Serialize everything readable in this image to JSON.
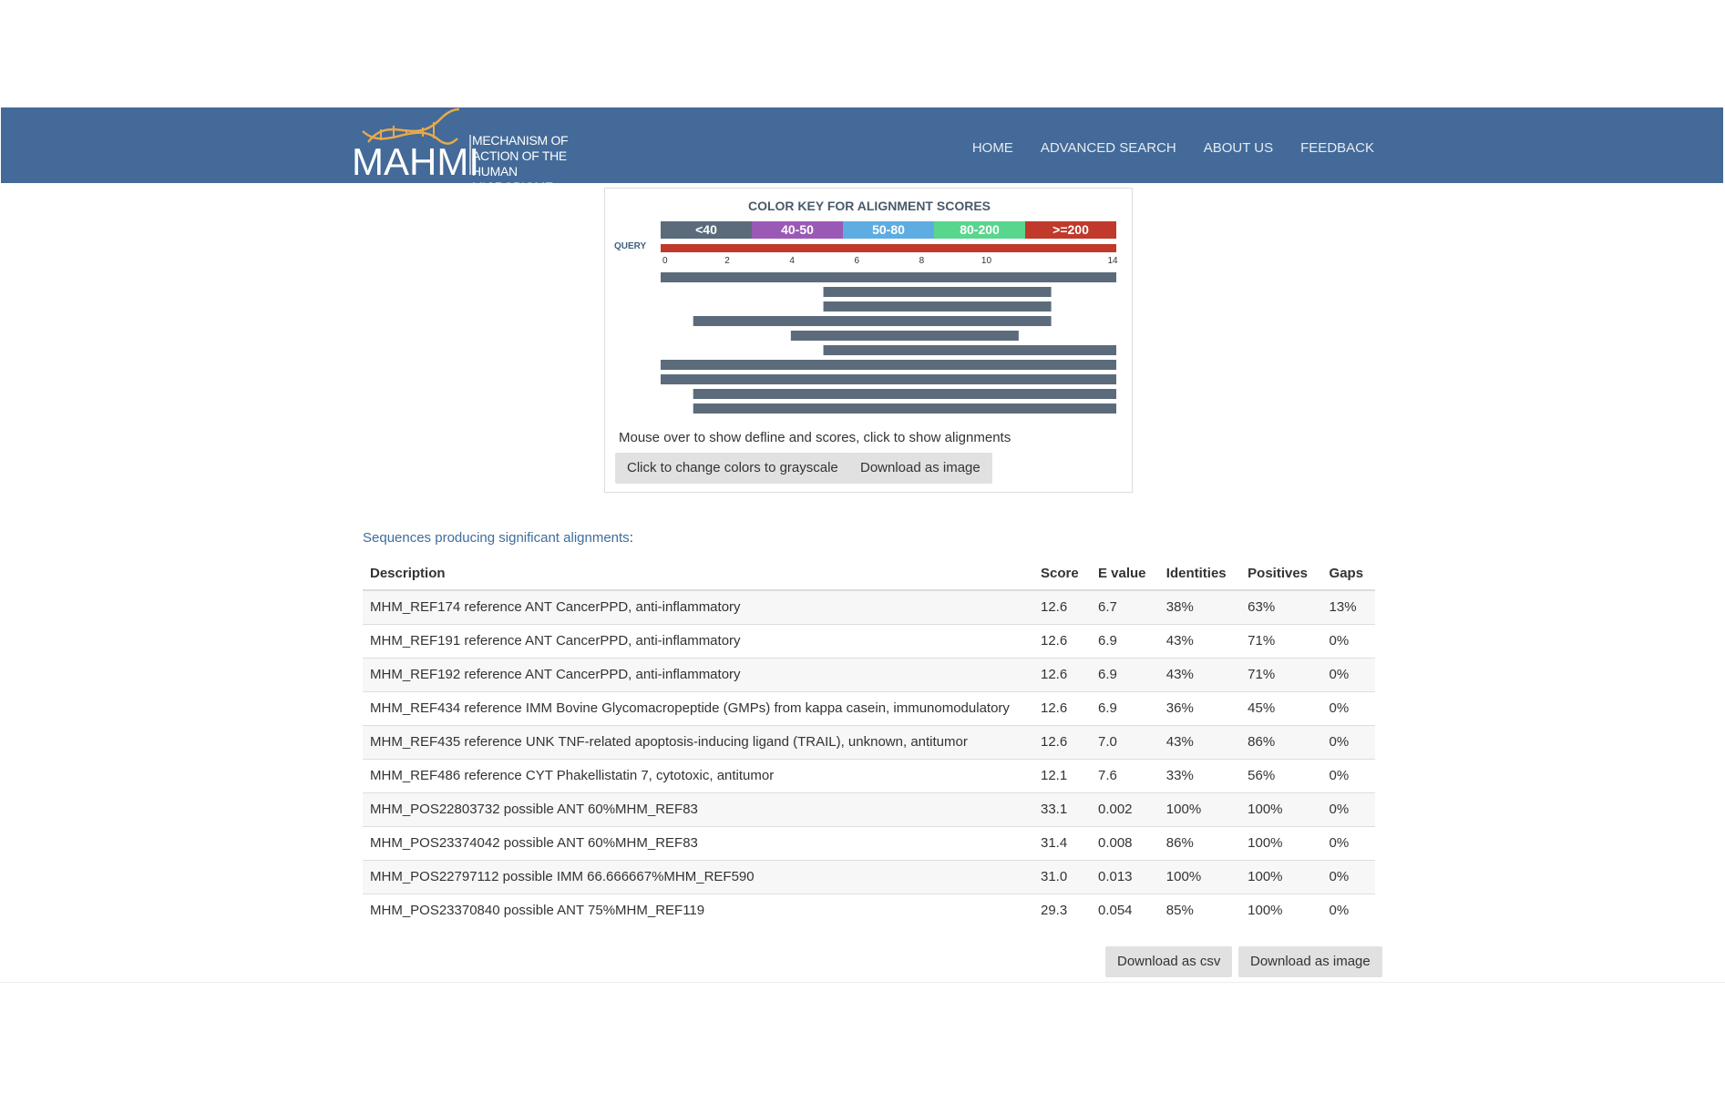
{
  "header": {
    "logo_text": "MAHMI",
    "tagline": [
      "MECHANISM OF",
      "ACTION OF THE",
      "HUMAN MICROBIOME"
    ],
    "nav": [
      "HOME",
      "ADVANCED SEARCH",
      "ABOUT US",
      "FEEDBACK"
    ],
    "colors": {
      "navbar": "#436a98",
      "logo_accent": "#e8a94a"
    }
  },
  "graphic": {
    "title": "COLOR KEY FOR ALIGNMENT SCORES",
    "legend": [
      {
        "label": "<40",
        "color": "#5b6b7b"
      },
      {
        "label": "40-50",
        "color": "#9b59b6"
      },
      {
        "label": "50-80",
        "color": "#5dade2"
      },
      {
        "label": "80-200",
        "color": "#58d68d"
      },
      {
        "label": ">=200",
        "color": "#c0392b"
      }
    ],
    "query_label": "QUERY",
    "query_color": "#c0392b",
    "axis_ticks": [
      "0",
      "2",
      "4",
      "6",
      "8",
      "10",
      "14"
    ],
    "axis_max": 14,
    "hits": [
      {
        "start": 0,
        "end": 14,
        "color": "#5b6b7b"
      },
      {
        "start": 5,
        "end": 12,
        "color": "#5b6b7b"
      },
      {
        "start": 5,
        "end": 12,
        "color": "#5b6b7b"
      },
      {
        "start": 1,
        "end": 12,
        "color": "#5b6b7b"
      },
      {
        "start": 4,
        "end": 11,
        "color": "#5b6b7b"
      },
      {
        "start": 5,
        "end": 14,
        "color": "#5b6b7b"
      },
      {
        "start": 0,
        "end": 14,
        "color": "#5b6b7b"
      },
      {
        "start": 0,
        "end": 14,
        "color": "#5b6b7b"
      },
      {
        "start": 1,
        "end": 14,
        "color": "#5b6b7b"
      },
      {
        "start": 1,
        "end": 14,
        "color": "#5b6b7b"
      }
    ],
    "help_text": "Mouse over to show defline and scores, click to show alignments",
    "grayscale_button": "Click to change colors to grayscale",
    "download_image_button": "Download as image"
  },
  "results": {
    "heading": "Sequences producing significant alignments",
    "heading_colon": ":",
    "columns": [
      "Description",
      "Score",
      "E value",
      "Identities",
      "Positives",
      "Gaps"
    ],
    "rows": [
      [
        "MHM_REF174 reference ANT CancerPPD, anti-inflammatory",
        "12.6",
        "6.7",
        "38%",
        "63%",
        "13%"
      ],
      [
        "MHM_REF191 reference ANT CancerPPD, anti-inflammatory",
        "12.6",
        "6.9",
        "43%",
        "71%",
        "0%"
      ],
      [
        "MHM_REF192 reference ANT CancerPPD, anti-inflammatory",
        "12.6",
        "6.9",
        "43%",
        "71%",
        "0%"
      ],
      [
        "MHM_REF434 reference IMM Bovine Glycomacropeptide (GMPs) from kappa casein, immunomodulatory",
        "12.6",
        "6.9",
        "36%",
        "45%",
        "0%"
      ],
      [
        "MHM_REF435 reference UNK TNF-related apoptosis-inducing ligand (TRAIL), unknown, antitumor",
        "12.6",
        "7.0",
        "43%",
        "86%",
        "0%"
      ],
      [
        "MHM_REF486 reference CYT Phakellistatin 7, cytotoxic, antitumor",
        "12.1",
        "7.6",
        "33%",
        "56%",
        "0%"
      ],
      [
        "MHM_POS22803732 possible ANT 60%MHM_REF83",
        "33.1",
        "0.002",
        "100%",
        "100%",
        "0%"
      ],
      [
        "MHM_POS23374042 possible ANT 60%MHM_REF83",
        "31.4",
        "0.008",
        "86%",
        "100%",
        "0%"
      ],
      [
        "MHM_POS22797112 possible IMM 66.666667%MHM_REF590",
        "31.0",
        "0.013",
        "100%",
        "100%",
        "0%"
      ],
      [
        "MHM_POS23370840 possible ANT 75%MHM_REF119",
        "29.3",
        "0.054",
        "85%",
        "100%",
        "0%"
      ]
    ],
    "download_csv_button": "Download as csv",
    "download_image_button": "Download as image"
  }
}
